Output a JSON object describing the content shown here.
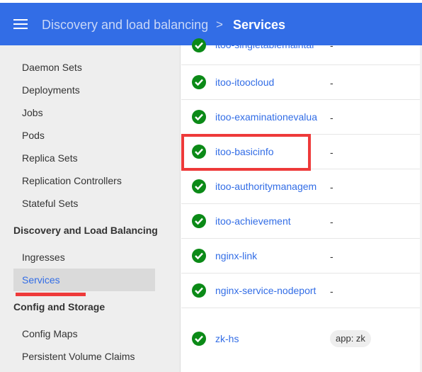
{
  "header": {
    "parent": "Discovery and load balancing",
    "separator": ">",
    "current": "Services"
  },
  "sidebar": {
    "items": [
      {
        "label": "Daemon Sets"
      },
      {
        "label": "Deployments"
      },
      {
        "label": "Jobs"
      },
      {
        "label": "Pods"
      },
      {
        "label": "Replica Sets"
      },
      {
        "label": "Replication Controllers"
      },
      {
        "label": "Stateful Sets"
      }
    ],
    "section_discovery": "Discovery and Load Balancing",
    "discovery_items": [
      {
        "label": "Ingresses"
      },
      {
        "label": "Services"
      }
    ],
    "section_config": "Config and Storage",
    "config_items": [
      {
        "label": "Config Maps"
      },
      {
        "label": "Persistent Volume Claims"
      }
    ]
  },
  "services": [
    {
      "name": "itoo-singletablemaintai",
      "labels": "-"
    },
    {
      "name": "itoo-itoocloud",
      "labels": "-"
    },
    {
      "name": "itoo-examinationevalua",
      "labels": "-"
    },
    {
      "name": "itoo-basicinfo",
      "labels": "-"
    },
    {
      "name": "itoo-authoritymanagem",
      "labels": "-"
    },
    {
      "name": "itoo-achievement",
      "labels": "-"
    },
    {
      "name": "nginx-link",
      "labels": "-"
    },
    {
      "name": "nginx-service-nodeport",
      "labels": "-"
    },
    {
      "name": "zk-hs",
      "labels": "app: zk"
    }
  ],
  "colors": {
    "brand": "#326de6",
    "status_ok": "#0b8a17",
    "annotation_red": "#ee3a3a"
  }
}
